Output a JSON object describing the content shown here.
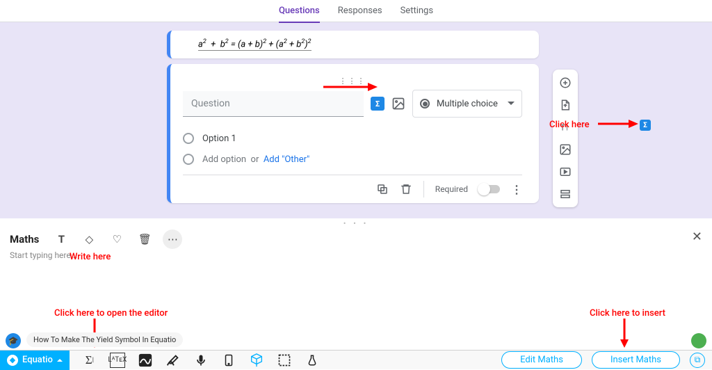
{
  "tabs": {
    "questions": "Questions",
    "responses": "Responses",
    "settings": "Settings"
  },
  "formula_card": {
    "content": "a² + b² = (a + b)² + (a² + b²)²"
  },
  "question_card": {
    "placeholder": "Question",
    "type_label": "Multiple choice",
    "option1": "Option 1",
    "add_option": "Add option",
    "or": "or",
    "add_other": "Add \"Other\"",
    "required_label": "Required"
  },
  "annotations": {
    "click_here": "Click here",
    "write_here": "Write here",
    "open_editor": "Click here to open the editor",
    "to_insert": "Click here to insert"
  },
  "maths_panel": {
    "title": "Maths",
    "placeholder": "Start typing here...",
    "how_to": "How To Make The Yield Symbol In Equatio"
  },
  "bottom": {
    "brand": "Equatio",
    "edit": "Edit Maths",
    "insert": "Insert Maths"
  },
  "icons": {
    "sigma": "Σ",
    "latex": "LᴬTᴇX"
  }
}
